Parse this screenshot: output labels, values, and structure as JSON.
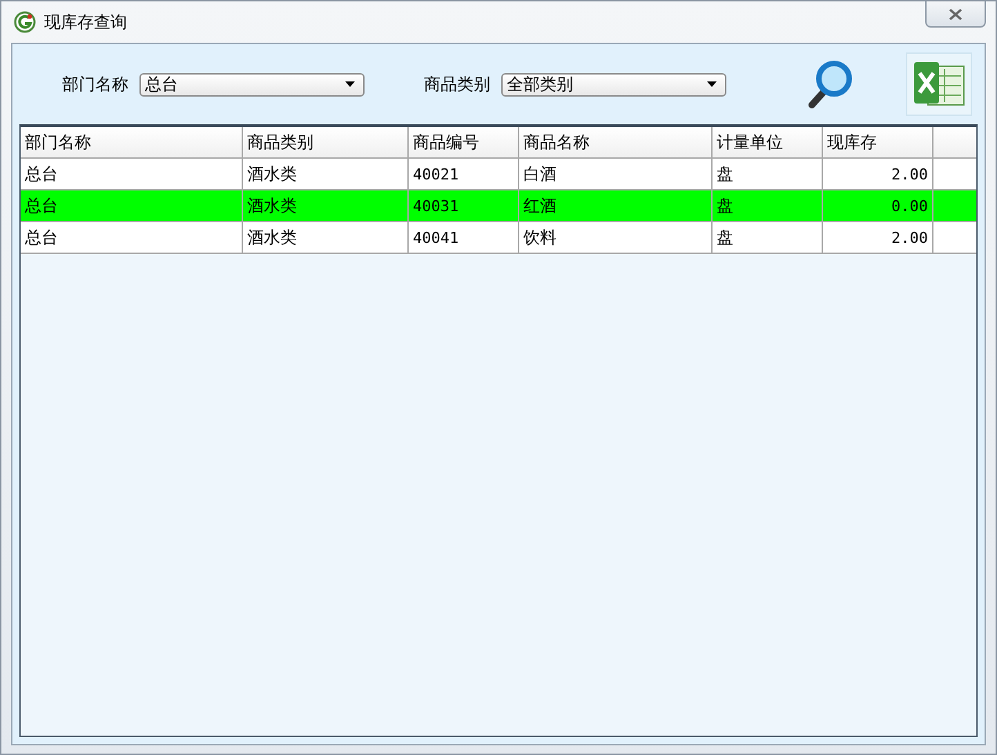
{
  "window": {
    "title": "现库存查询"
  },
  "filters": [
    {
      "label": "部门名称",
      "value": "总台"
    },
    {
      "label": "商品类别",
      "value": "全部类别"
    }
  ],
  "table": {
    "columns": [
      "部门名称",
      "商品类别",
      "商品编号",
      "商品名称",
      "计量单位",
      "现库存"
    ],
    "rows": [
      {
        "cells": [
          "总台",
          "酒水类",
          "40021",
          "白酒",
          "盘",
          "2.00"
        ],
        "selected": false
      },
      {
        "cells": [
          "总台",
          "酒水类",
          "40031",
          "红酒",
          "盘",
          "0.00"
        ],
        "selected": true
      },
      {
        "cells": [
          "总台",
          "酒水类",
          "40041",
          "饮料",
          "盘",
          "2.00"
        ],
        "selected": false
      }
    ]
  }
}
